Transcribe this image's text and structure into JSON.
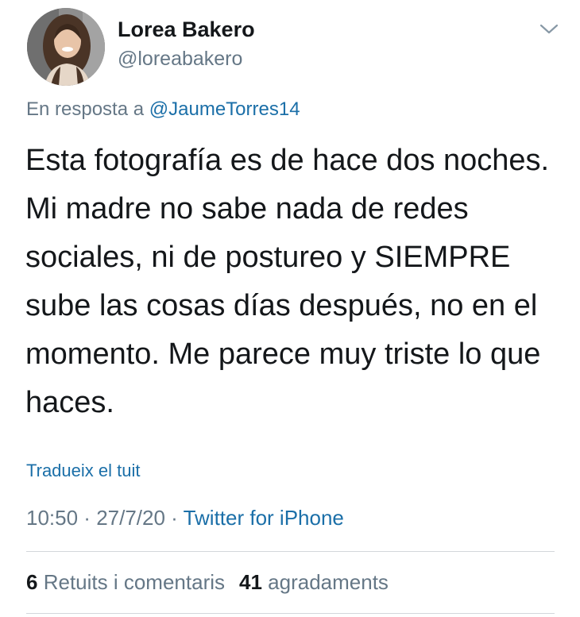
{
  "user": {
    "display_name": "Lorea Bakero",
    "handle": "@loreabakero"
  },
  "reply": {
    "prefix": "En resposta a",
    "mention": "@JaumeTorres14"
  },
  "tweet": {
    "text": "Esta fotografía es de hace dos noches. Mi madre no sabe nada de redes sociales, ni de postureo y SIEMPRE sube las cosas días después, no en el momento. Me parece muy triste lo que haces.",
    "translate_label": "Tradueix el tuit"
  },
  "meta": {
    "time": "10:50",
    "sep1": " · ",
    "date": "27/7/20",
    "sep2": " · ",
    "source": "Twitter for iPhone"
  },
  "stats": {
    "retweets_count": "6",
    "retweets_label": "Retuits i comentaris",
    "likes_count": "41",
    "likes_label": "agradaments"
  },
  "icons": {
    "menu": "chevron-down-icon",
    "avatar": "profile-photo"
  },
  "colors": {
    "link": "#1b6fa8",
    "secondary_text": "#657786",
    "primary_text": "#14171a",
    "divider": "#d3d7db"
  }
}
